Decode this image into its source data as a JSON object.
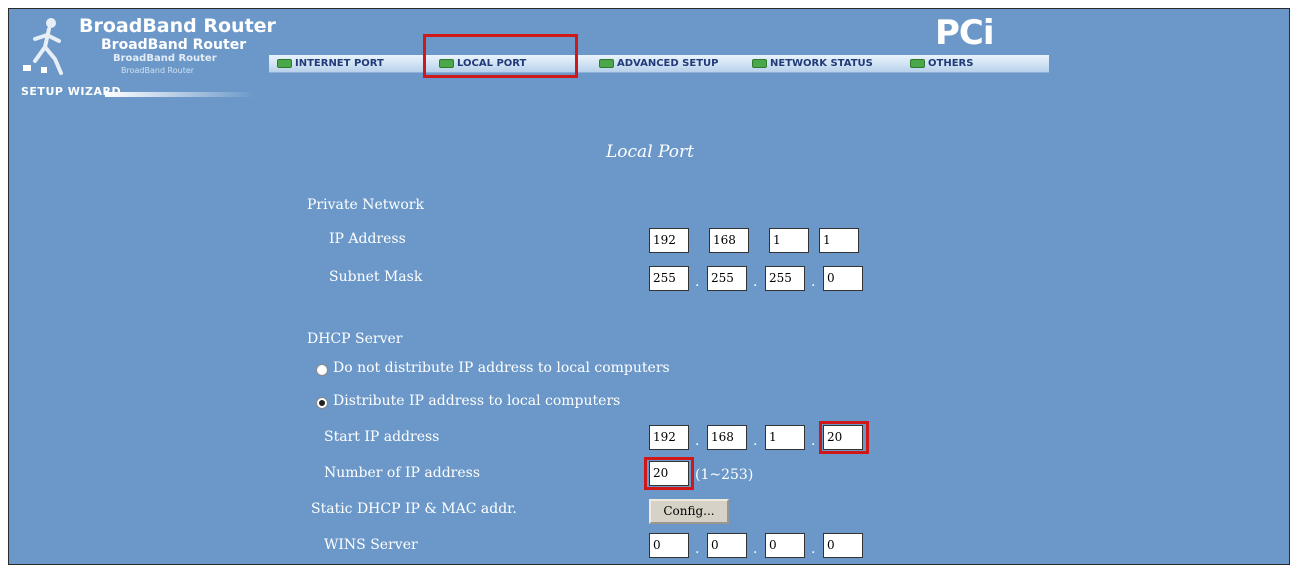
{
  "brand": {
    "line1": "BroadBand Router",
    "line2": "BroadBand Router",
    "line3": "BroadBand Router",
    "line4": "BroadBand Router",
    "wizard": "SETUP WIZARD",
    "pci_logo": "PCi"
  },
  "nav": {
    "tabs": [
      {
        "label": "INTERNET PORT"
      },
      {
        "label": "LOCAL PORT"
      },
      {
        "label": "ADVANCED SETUP"
      },
      {
        "label": "NETWORK STATUS"
      },
      {
        "label": "OTHERS"
      }
    ],
    "active": "LOCAL PORT"
  },
  "page": {
    "title": "Local Port",
    "private_network": {
      "heading": "Private Network",
      "ip_label": "IP Address",
      "ip": [
        "192",
        "168",
        "1",
        "1"
      ],
      "mask_label": "Subnet Mask",
      "mask": [
        "255",
        "255",
        "255",
        "0"
      ]
    },
    "dhcp": {
      "heading": "DHCP Server",
      "option_off": "Do not distribute IP address to local computers",
      "option_on": "Distribute IP address to local computers",
      "start_label": "Start IP address",
      "start_ip": [
        "192",
        "168",
        "1",
        "20"
      ],
      "count_label": "Number of IP address",
      "count": "20",
      "count_range": "(1~253)",
      "static_label": "Static DHCP IP & MAC addr.",
      "config_button": "Config...",
      "wins_label": "WINS Server",
      "wins": [
        "0",
        "0",
        "0",
        "0"
      ]
    }
  },
  "colors": {
    "background": "#6b98c8",
    "highlight": "#d01818"
  }
}
